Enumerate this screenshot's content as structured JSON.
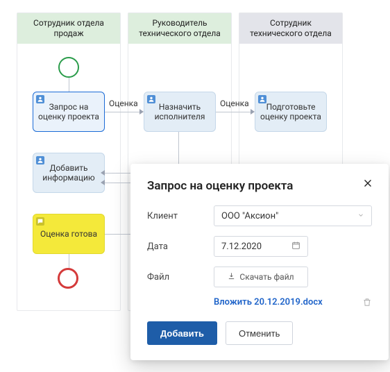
{
  "lanes": [
    {
      "title": "Сотрудник отдела продаж",
      "head_style": "green"
    },
    {
      "title": "Руководитель технического отдела",
      "head_style": "green"
    },
    {
      "title": "Сотрудник технического отдела",
      "head_style": "gray"
    }
  ],
  "tasks": {
    "request_estimate": "Запрос на оценку проекта",
    "assign_executor": "Назначить исполнителя",
    "prepare_estimate": "Подготовьте оценку проекта",
    "add_info": "Добавить информацию",
    "estimate_ready": "Оценка готова"
  },
  "edges": {
    "label_evaluate_1": "Оценка",
    "label_evaluate_2": "Оценка"
  },
  "modal": {
    "title": "Запрос на оценку проекта",
    "fields": {
      "client_label": "Клиент",
      "client_value": "ООО \"Аксион\"",
      "date_label": "Дата",
      "date_value": "7.12.2020",
      "file_label": "Файл",
      "file_button": "Скачать файл"
    },
    "attachment": "Вложить 20.12.2019.docx",
    "actions": {
      "submit": "Добавить",
      "cancel": "Отменить"
    }
  },
  "icons": {
    "person": "person-icon",
    "comment": "comment-icon",
    "chevron_down": "chevron-down-icon",
    "calendar": "calendar-icon",
    "download": "download-icon",
    "trash": "trash-icon",
    "close": "close-icon"
  },
  "colors": {
    "primary": "#1e5da8",
    "link": "#1e63c9",
    "start": "#2a9c4a",
    "end": "#d43a3a",
    "task_bg": "#e3edf6",
    "task_yellow": "#f4e93a"
  }
}
